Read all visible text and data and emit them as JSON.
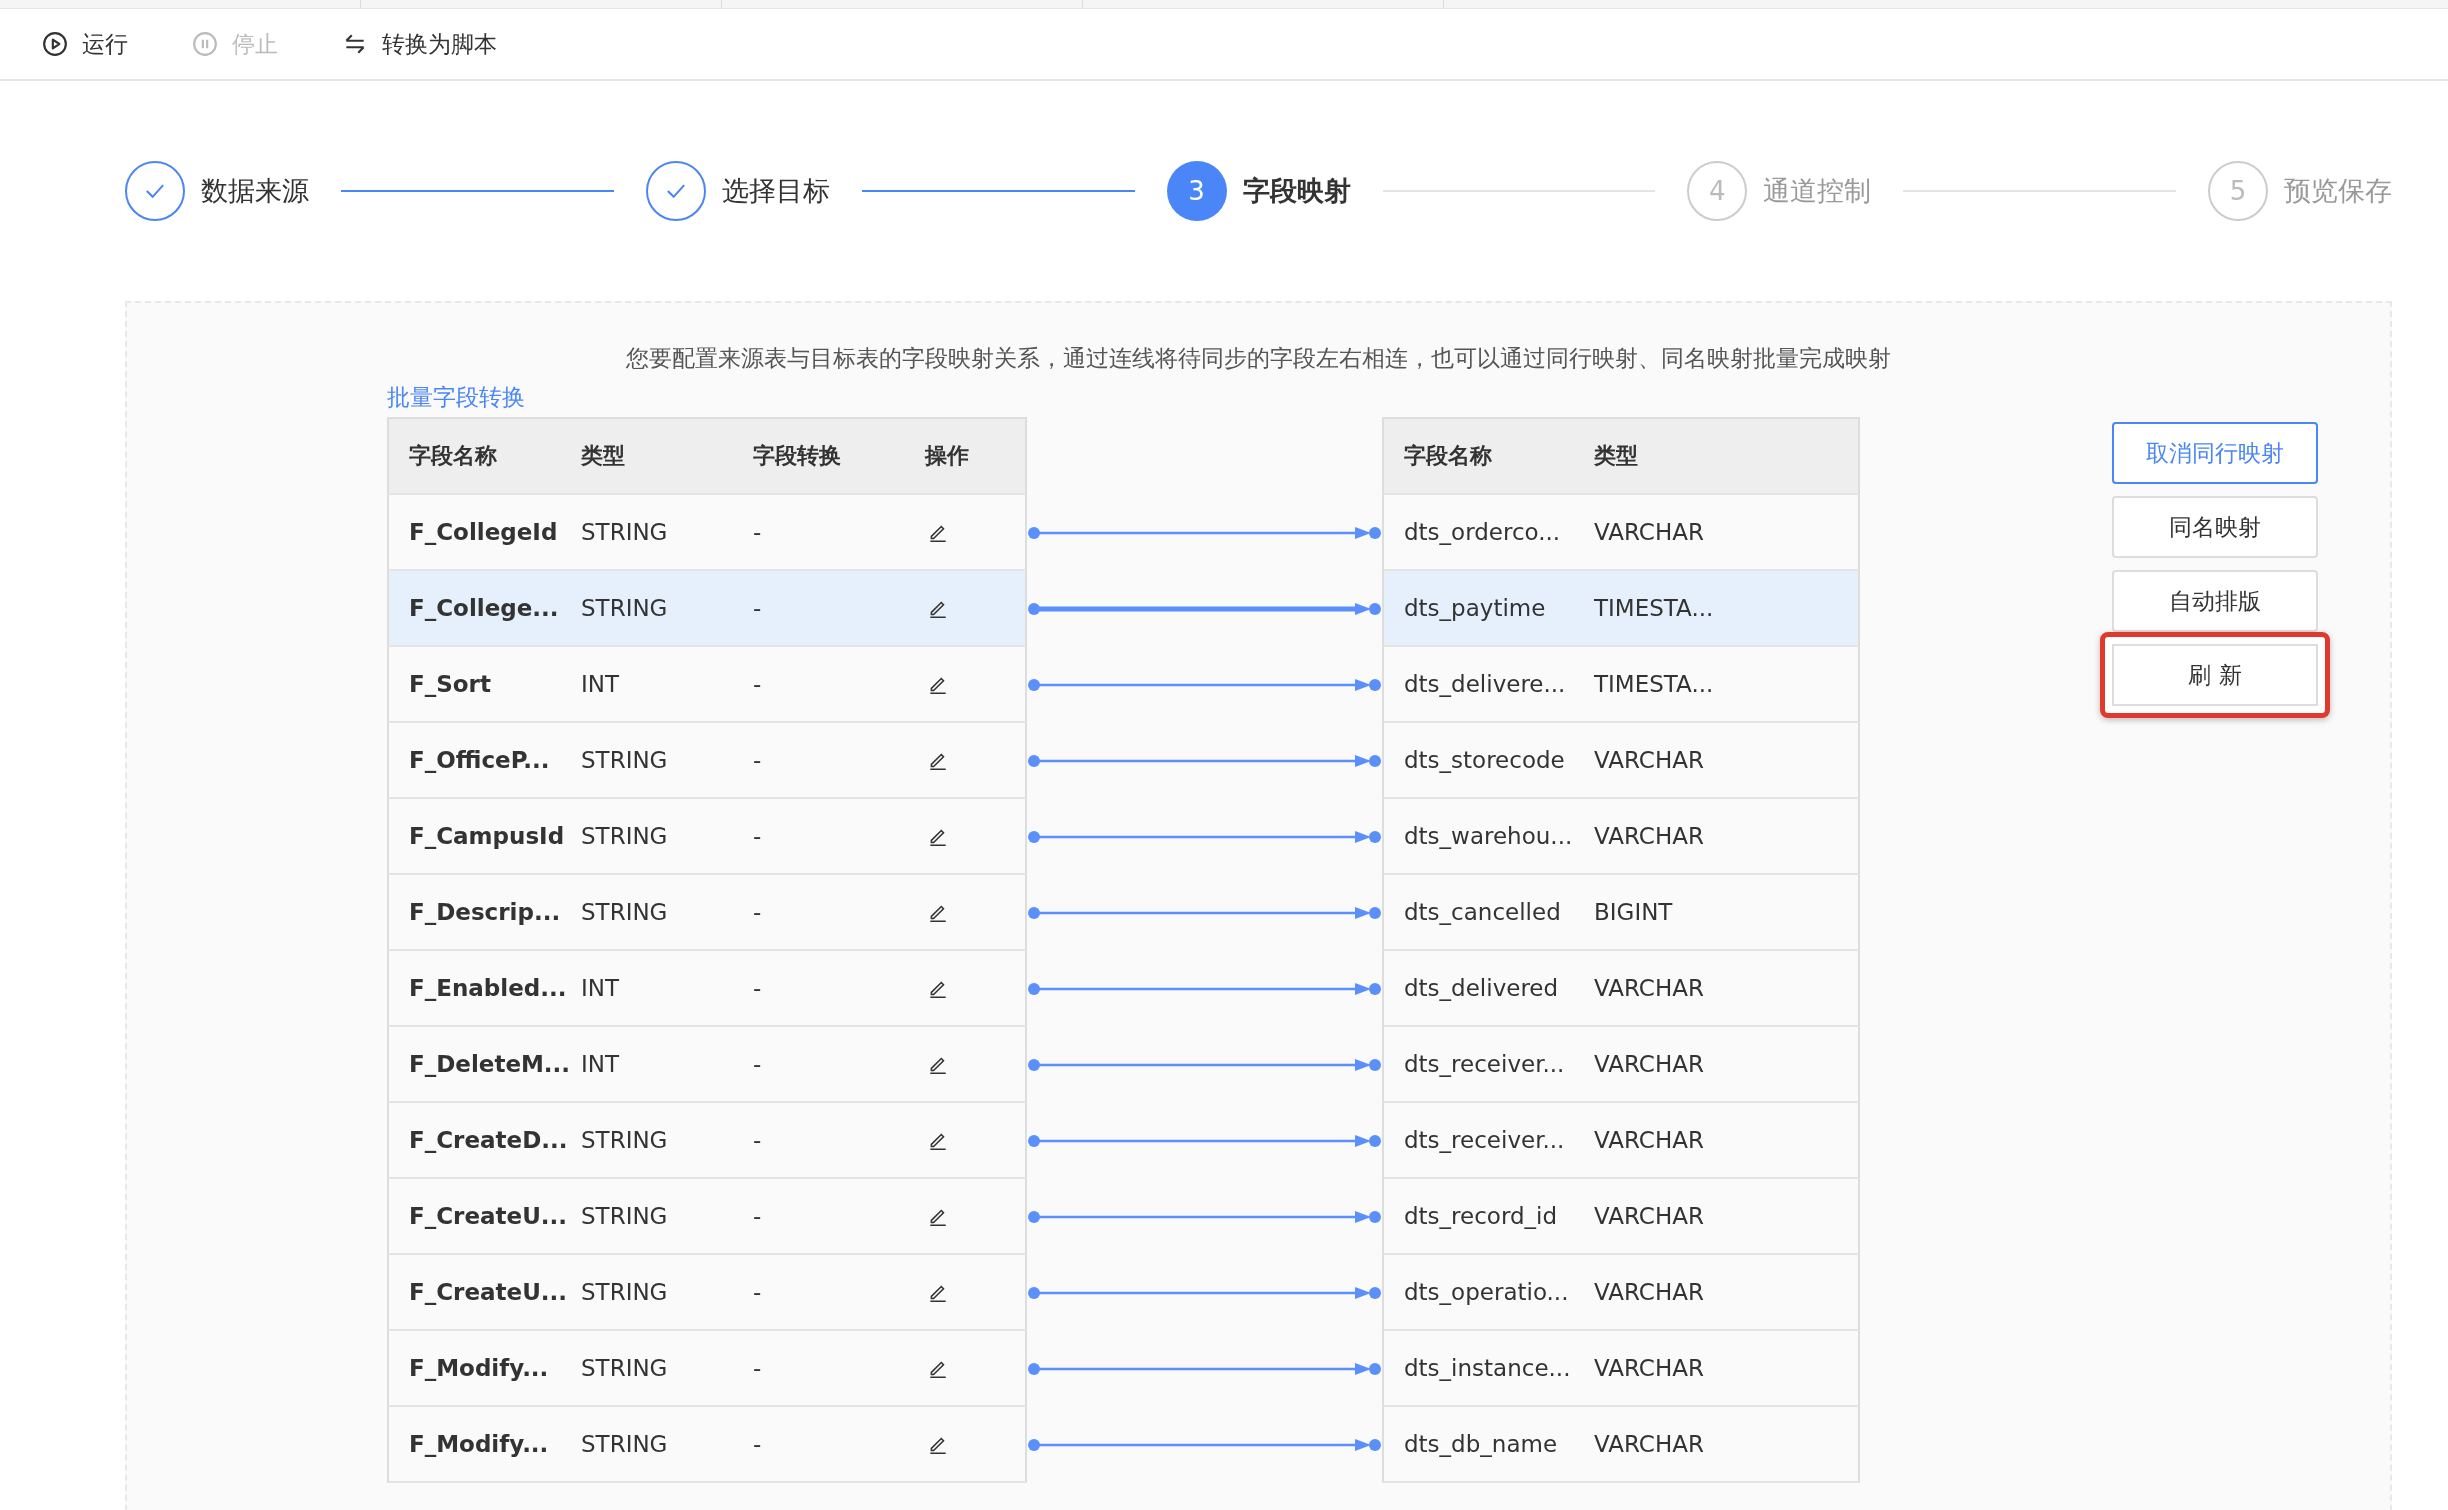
{
  "toolbar": [
    {
      "kind": "run",
      "label": "运行",
      "disabled": false
    },
    {
      "kind": "stop",
      "label": "停止",
      "disabled": true
    },
    {
      "kind": "convert",
      "label": "转换为脚本",
      "disabled": false
    }
  ],
  "steps": [
    {
      "label": "数据来源",
      "done": true,
      "active": false
    },
    {
      "label": "选择目标",
      "done": true,
      "active": false
    },
    {
      "number": "3",
      "label": "字段映射",
      "done": false,
      "active": true
    },
    {
      "number": "4",
      "label": "通道控制",
      "done": false,
      "active": false
    },
    {
      "number": "5",
      "label": "预览保存",
      "done": false,
      "active": false
    }
  ],
  "description": "您要配置来源表与目标表的字段映射关系，通过连线将待同步的字段左右相连，也可以通过同行映射、同名映射批量完成映射",
  "batch_link": "批量字段转换",
  "source_columns": [
    "字段名称",
    "类型",
    "字段转换",
    "操作"
  ],
  "target_columns": [
    "字段名称",
    "类型"
  ],
  "rows": [
    {
      "source_name": "F_CollegeId",
      "source_type": "STRING",
      "conversion": "-",
      "target_name": "dts_orderco...",
      "target_type": "VARCHAR",
      "selected": false
    },
    {
      "source_name": "F_College...",
      "source_type": "STRING",
      "conversion": "-",
      "target_name": "dts_paytime",
      "target_type": "TIMESTA...",
      "selected": true
    },
    {
      "source_name": "F_Sort",
      "source_type": "INT",
      "conversion": "-",
      "target_name": "dts_delivere...",
      "target_type": "TIMESTA...",
      "selected": false
    },
    {
      "source_name": "F_OfficeP...",
      "source_type": "STRING",
      "conversion": "-",
      "target_name": "dts_storecode",
      "target_type": "VARCHAR",
      "selected": false
    },
    {
      "source_name": "F_CampusId",
      "source_type": "STRING",
      "conversion": "-",
      "target_name": "dts_warehou...",
      "target_type": "VARCHAR",
      "selected": false
    },
    {
      "source_name": "F_Descrip...",
      "source_type": "STRING",
      "conversion": "-",
      "target_name": "dts_cancelled",
      "target_type": "BIGINT",
      "selected": false
    },
    {
      "source_name": "F_Enabled...",
      "source_type": "INT",
      "conversion": "-",
      "target_name": "dts_delivered",
      "target_type": "VARCHAR",
      "selected": false
    },
    {
      "source_name": "F_DeleteM...",
      "source_type": "INT",
      "conversion": "-",
      "target_name": "dts_receiver...",
      "target_type": "VARCHAR",
      "selected": false
    },
    {
      "source_name": "F_CreateD...",
      "source_type": "STRING",
      "conversion": "-",
      "target_name": "dts_receiver...",
      "target_type": "VARCHAR",
      "selected": false
    },
    {
      "source_name": "F_CreateU...",
      "source_type": "STRING",
      "conversion": "-",
      "target_name": "dts_record_id",
      "target_type": "VARCHAR",
      "selected": false
    },
    {
      "source_name": "F_CreateU...",
      "source_type": "STRING",
      "conversion": "-",
      "target_name": "dts_operatio...",
      "target_type": "VARCHAR",
      "selected": false
    },
    {
      "source_name": "F_Modify...",
      "source_type": "STRING",
      "conversion": "-",
      "target_name": "dts_instance...",
      "target_type": "VARCHAR",
      "selected": false
    },
    {
      "source_name": "F_Modify...",
      "source_type": "STRING",
      "conversion": "-",
      "target_name": "dts_db_name",
      "target_type": "VARCHAR",
      "selected": false
    }
  ],
  "buttons": [
    {
      "label": "取消同行映射",
      "kind": "primary",
      "highlighted": false
    },
    {
      "label": "同名映射",
      "kind": "default",
      "highlighted": false
    },
    {
      "label": "自动排版",
      "kind": "default",
      "highlighted": false
    },
    {
      "label": "刷 新",
      "kind": "default",
      "highlighted": true
    }
  ]
}
